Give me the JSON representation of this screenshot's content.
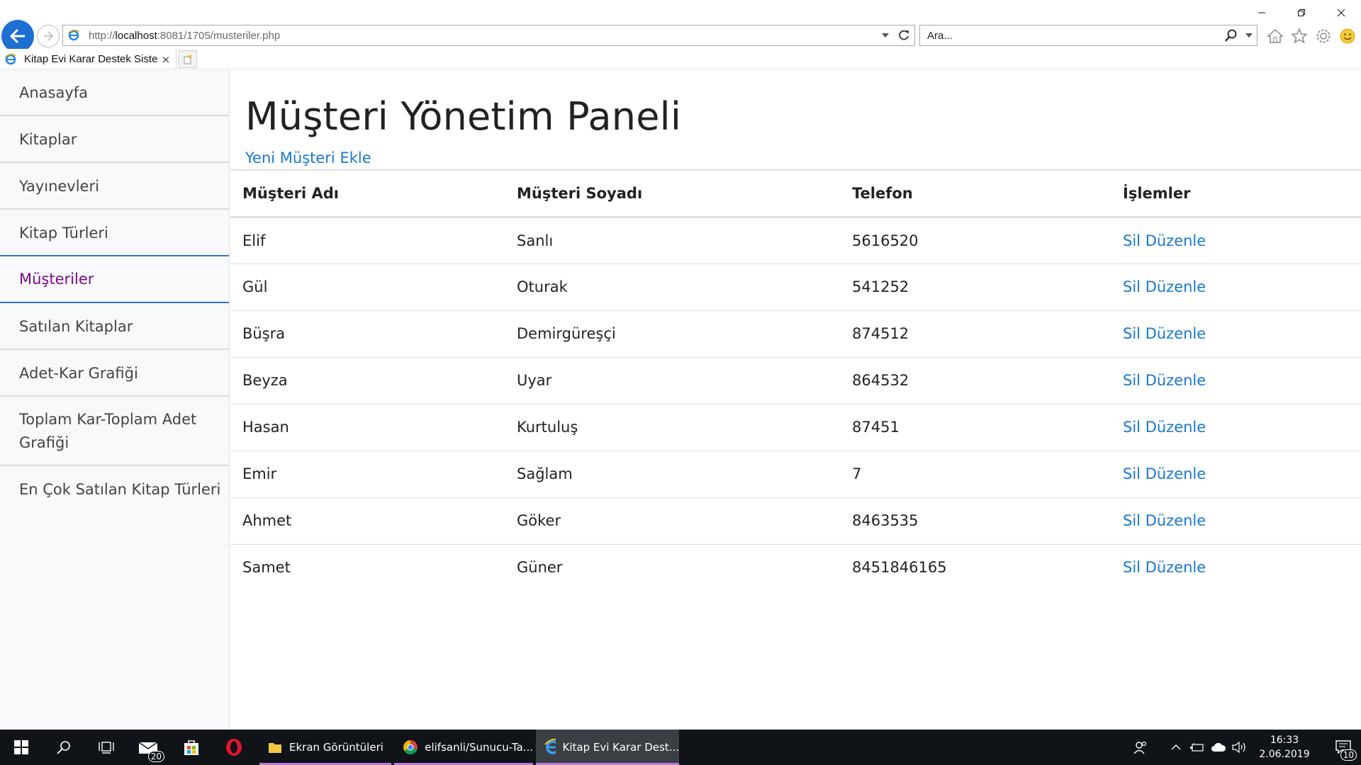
{
  "browser": {
    "url_prefix": "http://",
    "url_host": "localhost",
    "url_rest": ":8081/1705/musteriler.php",
    "search_placeholder": "Ara...",
    "tab_title": "Kitap Evi Karar Destek Siste...",
    "tab_close": "×"
  },
  "sidebar": {
    "items": [
      {
        "label": "Anasayfa"
      },
      {
        "label": "Kitaplar"
      },
      {
        "label": "Yayınevleri"
      },
      {
        "label": "Kitap Türleri"
      },
      {
        "label": "Müşteriler",
        "active": true
      },
      {
        "label": "Satılan Kitaplar"
      },
      {
        "label": "Adet-Kar Grafiği"
      },
      {
        "label": "Toplam Kar-Toplam Adet Grafiği"
      },
      {
        "label": "En Çok Satılan Kitap Türleri"
      }
    ]
  },
  "main": {
    "title": "Müşteri Yönetim Paneli",
    "add_link": "Yeni Müşteri Ekle",
    "table": {
      "headers": [
        "Müşteri Adı",
        "Müşteri Soyadı",
        "Telefon",
        "İşlemler"
      ],
      "rows": [
        {
          "ad": "Elif",
          "soyad": "Sanlı",
          "telefon": "5616520"
        },
        {
          "ad": "Gül",
          "soyad": "Oturak",
          "telefon": "541252"
        },
        {
          "ad": "Büşra",
          "soyad": "Demirgüreşçi",
          "telefon": "874512"
        },
        {
          "ad": "Beyza",
          "soyad": "Uyar",
          "telefon": "864532"
        },
        {
          "ad": "Hasan",
          "soyad": "Kurtuluş",
          "telefon": "87451"
        },
        {
          "ad": "Emir",
          "soyad": "Sağlam",
          "telefon": "7"
        },
        {
          "ad": "Ahmet",
          "soyad": "Göker",
          "telefon": "8463535"
        },
        {
          "ad": "Samet",
          "soyad": "Güner",
          "telefon": "8451846165"
        }
      ],
      "delete_label": "Sil",
      "edit_label": "Düzenle"
    }
  },
  "taskbar": {
    "mail_badge": "20",
    "apps": [
      {
        "label": "Ekran Görüntüleri"
      },
      {
        "label": "elifsanli/Sunucu-Ta..."
      },
      {
        "label": "Kitap Evi Karar Dest..."
      }
    ],
    "time": "16:33",
    "date": "2.06.2019",
    "notif_count": "10"
  },
  "colors": {
    "link": "#1877d2",
    "active_menu": "#7a0a8a",
    "active_border": "#2f76d1",
    "taskbar_bg": "#101418"
  }
}
